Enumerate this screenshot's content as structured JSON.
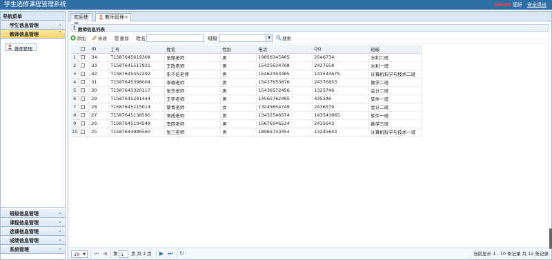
{
  "app": {
    "title": "学生选修课程管理系统",
    "user": "admin",
    "greeting": "您好",
    "logout": "安全退出"
  },
  "sidebar": {
    "header": "导航菜单",
    "top_groups": [
      {
        "label": "学生信息管理"
      },
      {
        "label": "教师信息管理"
      }
    ],
    "active_item": "教师管理",
    "bottom_groups": [
      {
        "label": "班级信息管理"
      },
      {
        "label": "课程信息管理"
      },
      {
        "label": "选课信息管理"
      },
      {
        "label": "成绩信息管理"
      },
      {
        "label": "系统管理"
      }
    ]
  },
  "tabs": [
    {
      "label": "欢迎使用"
    },
    {
      "label": "教师管理"
    }
  ],
  "panel": {
    "title": "教师信息列表"
  },
  "toolbar": {
    "add": "添加",
    "edit": "修改",
    "delete": "删除",
    "name_label": "姓名",
    "name_value": "",
    "class_label": "班级",
    "class_value": "",
    "search": "搜索"
  },
  "table": {
    "columns": [
      "ID",
      "工号",
      "姓名",
      "性别",
      "电话",
      "QQ",
      "班级"
    ],
    "rows": [
      {
        "n": "1",
        "id": "34",
        "no": "T1587645619308",
        "name": "张翔老师",
        "sex": "男",
        "phone": "19856345465",
        "qq": "2546734",
        "cls": "水利二班"
      },
      {
        "n": "2",
        "id": "33",
        "no": "T1587645517931",
        "name": "王政老师",
        "sex": "男",
        "phone": "15425634768",
        "qq": "2437658",
        "cls": "水利一班"
      },
      {
        "n": "3",
        "id": "32",
        "no": "T1587645452292",
        "name": "朱子伦老师",
        "sex": "男",
        "phone": "15462353465",
        "qq": "143543675",
        "cls": "计算机科学与技术二班"
      },
      {
        "n": "4",
        "id": "31",
        "no": "T1587645398004",
        "name": "李楠老师",
        "sex": "男",
        "phone": "15437653876",
        "qq": "24376853",
        "cls": "数学二班"
      },
      {
        "n": "5",
        "id": "30",
        "no": "T1587645320117",
        "name": "张华老师",
        "sex": "男",
        "phone": "15436572456",
        "qq": "1325746",
        "cls": "会计二班"
      },
      {
        "n": "6",
        "id": "29",
        "no": "T1587645281444",
        "name": "王宇老师",
        "sex": "男",
        "phone": "14565762465",
        "qq": "435346",
        "cls": "软件一班"
      },
      {
        "n": "7",
        "id": "28",
        "no": "T1587645215014",
        "name": "黎青老师",
        "sex": "女",
        "phone": "13245654749",
        "qq": "2436579",
        "cls": "会计二班"
      },
      {
        "n": "8",
        "id": "27",
        "no": "T1587645138590",
        "name": "李成老师",
        "sex": "男",
        "phone": "13432546574",
        "qq": "143543665",
        "cls": "软件一班"
      },
      {
        "n": "9",
        "id": "26",
        "no": "T1587645104549",
        "name": "李四老师",
        "sex": "男",
        "phone": "15676546534",
        "qq": "2435643",
        "cls": "数学三班"
      },
      {
        "n": "10",
        "id": "25",
        "no": "T1587644986560",
        "name": "张三老师",
        "sex": "男",
        "phone": "18965743454",
        "qq": "13245643",
        "cls": "计算机科学与技术一班"
      }
    ]
  },
  "pager": {
    "page_size": "10",
    "page_prefix": "第",
    "page_value": "1",
    "page_suffix": "页 共 2 页",
    "info": "当前显示 1 - 10 条记录 共 12 条记录"
  },
  "colors": {
    "topbar": "#2f6ea5",
    "admin": "#ff3b3b",
    "active_group": "#fbd36a"
  }
}
